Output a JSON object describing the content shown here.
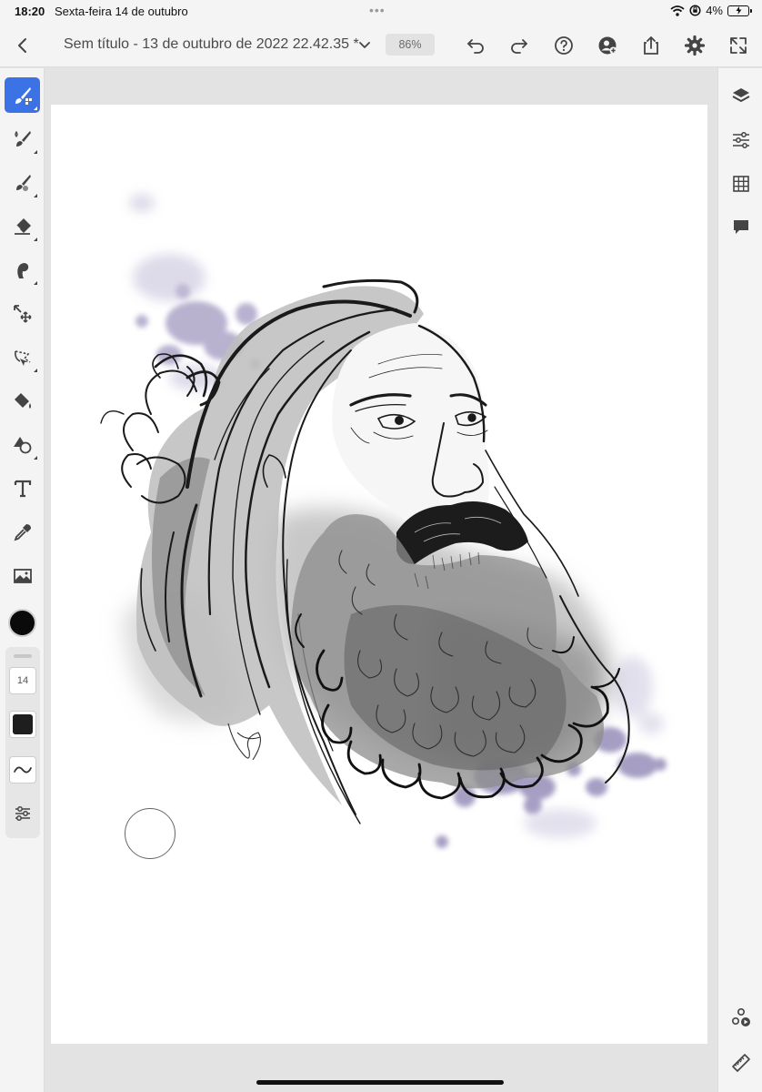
{
  "status_bar": {
    "time": "18:20",
    "date": "Sexta-feira 14 de outubro",
    "battery": "4%",
    "dots": "•••"
  },
  "toolbar": {
    "title": "Sem título - 13 de outubro de 2022 22.42.35 *",
    "zoom": "86%",
    "icons": [
      "back-icon",
      "chevron-down-icon",
      "undo-icon",
      "redo-icon",
      "help-icon",
      "add-user-icon",
      "share-icon",
      "gear-icon",
      "fullscreen-icon"
    ]
  },
  "left_tools": [
    "brush-pixel-icon",
    "brush-live-icon",
    "brush-vector-icon",
    "eraser-icon",
    "smudge-icon",
    "move-transform-icon",
    "lasso-select-icon",
    "fill-bucket-icon",
    "shapes-icon",
    "text-icon",
    "eyedropper-icon",
    "image-icon"
  ],
  "brush_panel": {
    "size": "14",
    "color": "#0a0a0a",
    "opacity_color": "#1e1e1e"
  },
  "right_tools": [
    "layers-icon",
    "adjustments-icon",
    "grid-icon",
    "comment-icon",
    "share-live-icon",
    "ruler-icon"
  ],
  "colors": {
    "accent": "#3b73e6",
    "paint_splatter": "#a79fc4"
  }
}
